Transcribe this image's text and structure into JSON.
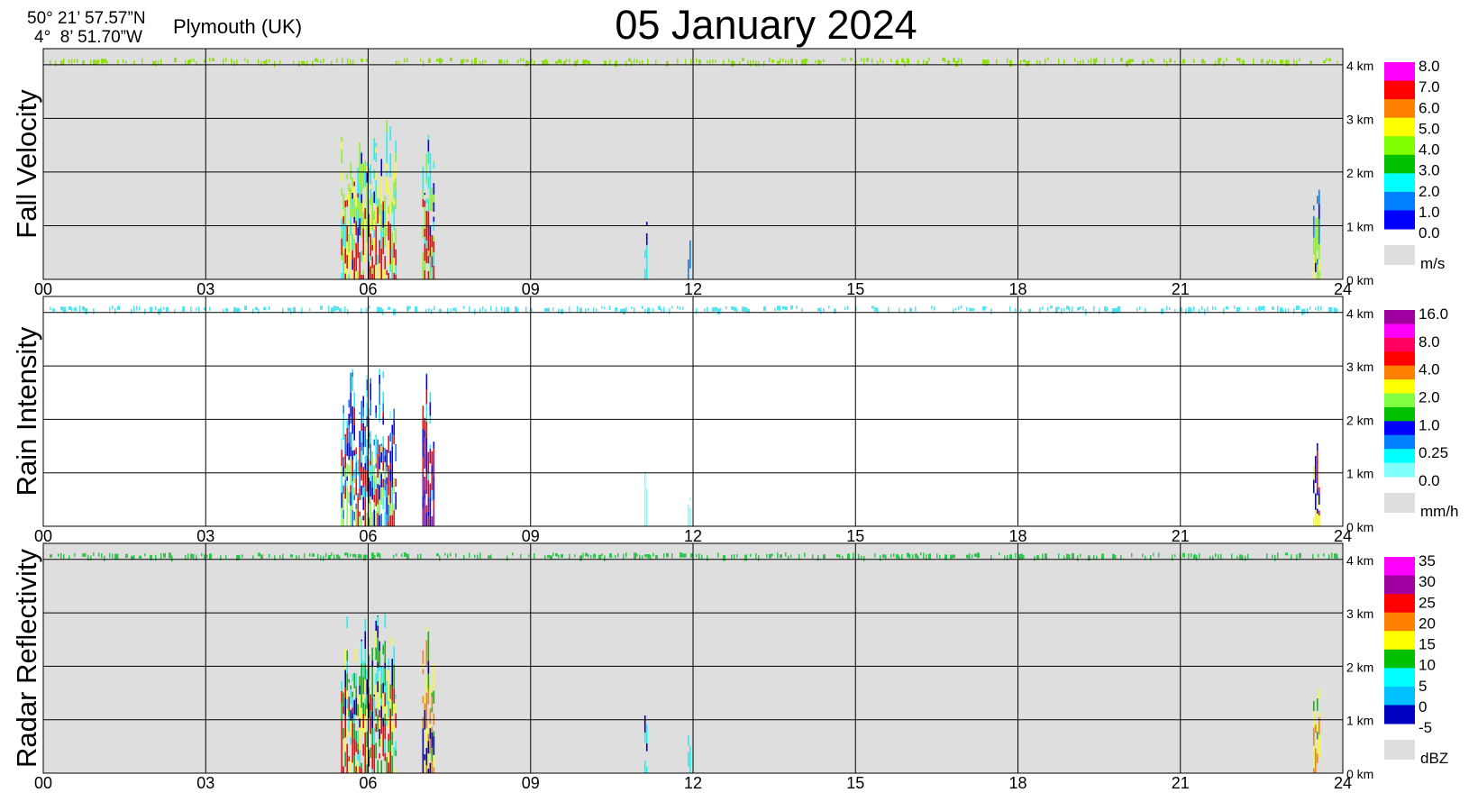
{
  "header": {
    "latitude": "50° 21’ 57.57”N",
    "longitude": "4°  8’ 51.70”W",
    "location": "Plymouth (UK)",
    "title": "05 January  2024"
  },
  "chart_data": [
    {
      "type": "heatmap",
      "title": "",
      "ylabel": "Fall Velocity",
      "x_ticks": [
        "00",
        "03",
        "06",
        "09",
        "12",
        "15",
        "18",
        "21",
        "24"
      ],
      "xlim": [
        0,
        24
      ],
      "y_ticks": [
        "0 km",
        "1 km",
        "2 km",
        "3 km",
        "4 km"
      ],
      "ylim_km": [
        0,
        4.3
      ],
      "background": "#dedede",
      "colorbar": {
        "unit": "m/s",
        "labels": [
          "8.0",
          "7.0",
          "6.0",
          "5.0",
          "4.0",
          "3.0",
          "2.0",
          "1.0",
          "0.0"
        ],
        "colors": [
          "#ff00ff",
          "#ff0000",
          "#ff8000",
          "#ffff00",
          "#80ff00",
          "#00c000",
          "#00ffff",
          "#0080ff",
          "#0000ff"
        ]
      },
      "top_band_color": "#88e000",
      "events": [
        {
          "start_h": 5.5,
          "end_h": 6.5,
          "top_km": 3.0,
          "colors": [
            "#0000ff",
            "#00ffff",
            "#80ff00",
            "#ffff00",
            "#ff0000"
          ]
        },
        {
          "start_h": 7.0,
          "end_h": 7.2,
          "top_km": 3.0,
          "colors": [
            "#0000ff",
            "#00ffff",
            "#80ff00",
            "#ff0000"
          ]
        },
        {
          "start_h": 11.1,
          "end_h": 11.15,
          "top_km": 1.2,
          "colors": [
            "#0000ff",
            "#00ffff"
          ]
        },
        {
          "start_h": 11.9,
          "end_h": 11.95,
          "top_km": 0.9,
          "colors": [
            "#00ffff",
            "#0080ff"
          ]
        },
        {
          "start_h": 23.45,
          "end_h": 23.55,
          "top_km": 1.7,
          "colors": [
            "#0000ff",
            "#0080ff",
            "#80ff00",
            "#ffff00"
          ]
        }
      ]
    },
    {
      "type": "heatmap",
      "title": "",
      "ylabel": "Rain Intensity",
      "x_ticks": [
        "00",
        "03",
        "06",
        "09",
        "12",
        "15",
        "18",
        "21",
        "24"
      ],
      "xlim": [
        0,
        24
      ],
      "y_ticks": [
        "0 km",
        "1 km",
        "2 km",
        "3 km",
        "4 km"
      ],
      "ylim_km": [
        0,
        4.3
      ],
      "background": "#ffffff",
      "colorbar": {
        "unit": "mm/h",
        "labels": [
          "16.0",
          "8.0",
          "4.0",
          "2.0",
          "1.0",
          "0.25",
          "0.0"
        ],
        "colors": [
          "#a000a0",
          "#ff00ff",
          "#ff0060",
          "#ff0000",
          "#ff8000",
          "#ffff00",
          "#80ff40",
          "#00c000",
          "#0000ff",
          "#0080ff",
          "#00ffff",
          "#80ffff"
        ]
      },
      "top_band_color": "#40e0f0",
      "events": [
        {
          "start_h": 5.5,
          "end_h": 6.5,
          "top_km": 3.0,
          "colors": [
            "#80ffff",
            "#00ffff",
            "#0080ff",
            "#0000ff",
            "#ff0000",
            "#80ff40"
          ]
        },
        {
          "start_h": 7.0,
          "end_h": 7.2,
          "top_km": 3.0,
          "colors": [
            "#00ffff",
            "#0000ff",
            "#ff0000",
            "#a000a0"
          ]
        },
        {
          "start_h": 11.1,
          "end_h": 11.15,
          "top_km": 1.2,
          "colors": [
            "#80ffff"
          ]
        },
        {
          "start_h": 11.9,
          "end_h": 11.95,
          "top_km": 0.9,
          "colors": [
            "#80ffff"
          ]
        },
        {
          "start_h": 23.45,
          "end_h": 23.55,
          "top_km": 1.7,
          "colors": [
            "#00ffff",
            "#0000ff",
            "#ff0000",
            "#ffff00"
          ]
        }
      ]
    },
    {
      "type": "heatmap",
      "title": "",
      "ylabel": "Radar Reflectivity",
      "x_ticks": [
        "00",
        "03",
        "06",
        "09",
        "12",
        "15",
        "18",
        "21",
        "24"
      ],
      "xlim": [
        0,
        24
      ],
      "y_ticks": [
        "0 km",
        "1 km",
        "2 km",
        "3 km",
        "4 km"
      ],
      "ylim_km": [
        0,
        4.3
      ],
      "background": "#dedede",
      "colorbar": {
        "unit": "dBZ",
        "labels": [
          "35",
          "30",
          "25",
          "20",
          "15",
          "10",
          "5",
          "0",
          "-5"
        ],
        "colors": [
          "#ff00ff",
          "#a000a0",
          "#ff0000",
          "#ff8000",
          "#ffff00",
          "#00c000",
          "#00ffff",
          "#00c0ff",
          "#0000c0"
        ]
      },
      "top_band_color": "#20c040",
      "events": [
        {
          "start_h": 5.5,
          "end_h": 6.5,
          "top_km": 3.0,
          "colors": [
            "#0000c0",
            "#00ffff",
            "#00c000",
            "#ffff00",
            "#ff0000"
          ]
        },
        {
          "start_h": 7.0,
          "end_h": 7.2,
          "top_km": 3.0,
          "colors": [
            "#00c000",
            "#ffff00",
            "#ff8000",
            "#0000c0"
          ]
        },
        {
          "start_h": 11.1,
          "end_h": 11.15,
          "top_km": 1.2,
          "colors": [
            "#0000c0",
            "#00ffff"
          ]
        },
        {
          "start_h": 11.9,
          "end_h": 11.95,
          "top_km": 0.9,
          "colors": [
            "#0000c0",
            "#00ffff"
          ]
        },
        {
          "start_h": 23.45,
          "end_h": 23.55,
          "top_km": 1.7,
          "colors": [
            "#00c000",
            "#ffff00",
            "#ff8000"
          ]
        }
      ]
    }
  ]
}
